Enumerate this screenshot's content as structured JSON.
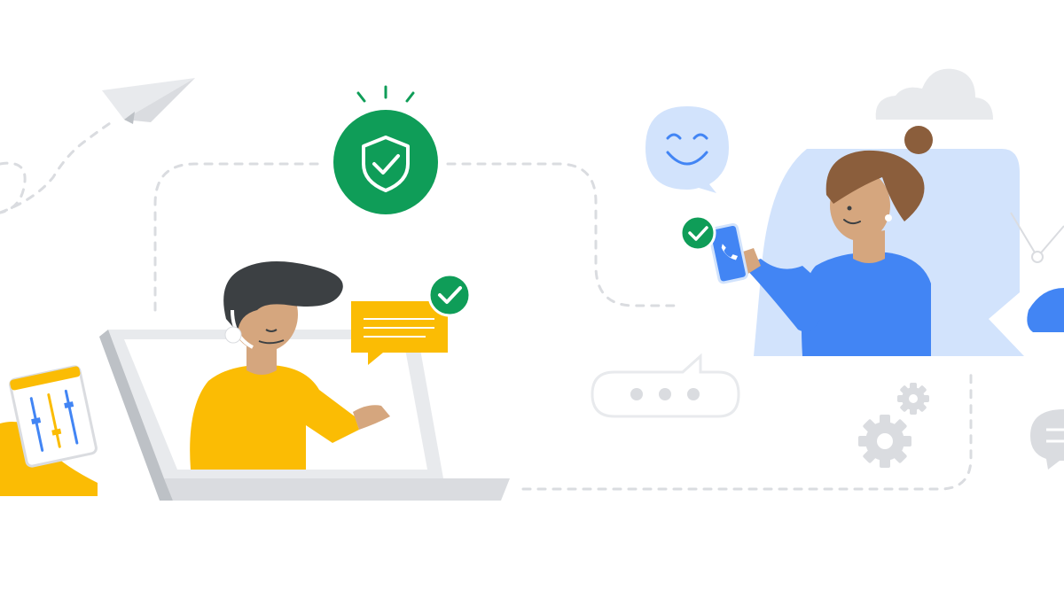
{
  "palette": {
    "background": "#ffffff",
    "green": "#0f9d58",
    "yellow": "#fbbc04",
    "blue": "#4285f4",
    "light_blue": "#d2e3fc",
    "grey": "#dadce0",
    "dark_grey": "#3c4043",
    "skin": "#d5a67e",
    "hair_brown": "#8b5e3c"
  },
  "icons": [
    "paper-plane-icon",
    "shield-check-icon",
    "smiley-face-icon",
    "cloud-icon",
    "chat-bubble-icon",
    "typing-bubble-icon",
    "gear-icon",
    "checkmark-icon",
    "phone-icon",
    "sliders-icon"
  ]
}
